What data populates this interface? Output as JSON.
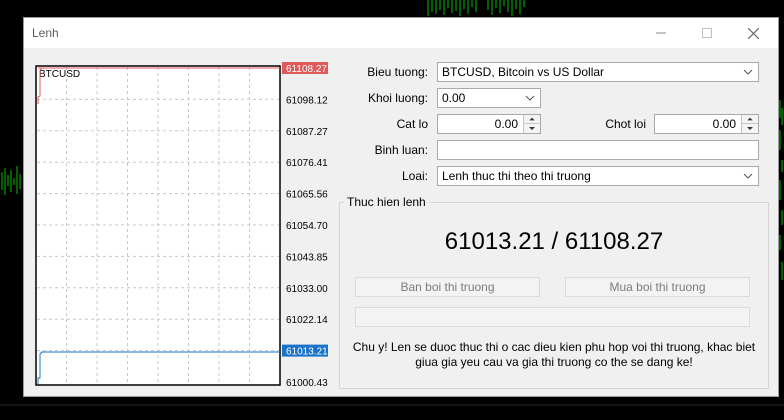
{
  "window": {
    "title": "Lenh",
    "controls": {
      "minimize": "minimize-icon",
      "maximize": "maximize-icon",
      "close": "close-icon"
    }
  },
  "mini_chart": {
    "symbol": "BTCUSD",
    "price_axis": [
      "61108.27",
      "61098.12",
      "61087.27",
      "61076.41",
      "61065.56",
      "61054.70",
      "61043.85",
      "61033.00",
      "61022.14",
      "61013.21",
      "61000.43"
    ],
    "ask_price": "61108.27",
    "bid_price": "61013.21",
    "ask_color": "#e05a5a",
    "bid_color": "#1a73c8"
  },
  "form": {
    "symbol_label": "Bieu tuong:",
    "symbol_value": "BTCUSD, Bitcoin vs US Dollar",
    "volume_label": "Khoi luong:",
    "volume_value": "0.00",
    "stop_loss_label": "Cat lo",
    "stop_loss_value": "0.00",
    "take_profit_label": "Chot loi",
    "take_profit_value": "0.00",
    "comment_label": "Binh luan:",
    "comment_value": "",
    "type_label": "Loai:",
    "type_value": "Lenh thuc thi theo thi truong"
  },
  "execution": {
    "group_title": "Thuc hien lenh",
    "price_display": "61013.21 / 61108.27",
    "sell_button": "Ban boi thi truong",
    "buy_button": "Mua boi thi truong",
    "note": "Chu y! Len se duoc thuc thi o cac dieu kien phu hop voi thi truong, khac biet giua gia yeu cau va gia thi truong co the se dang ke!"
  }
}
